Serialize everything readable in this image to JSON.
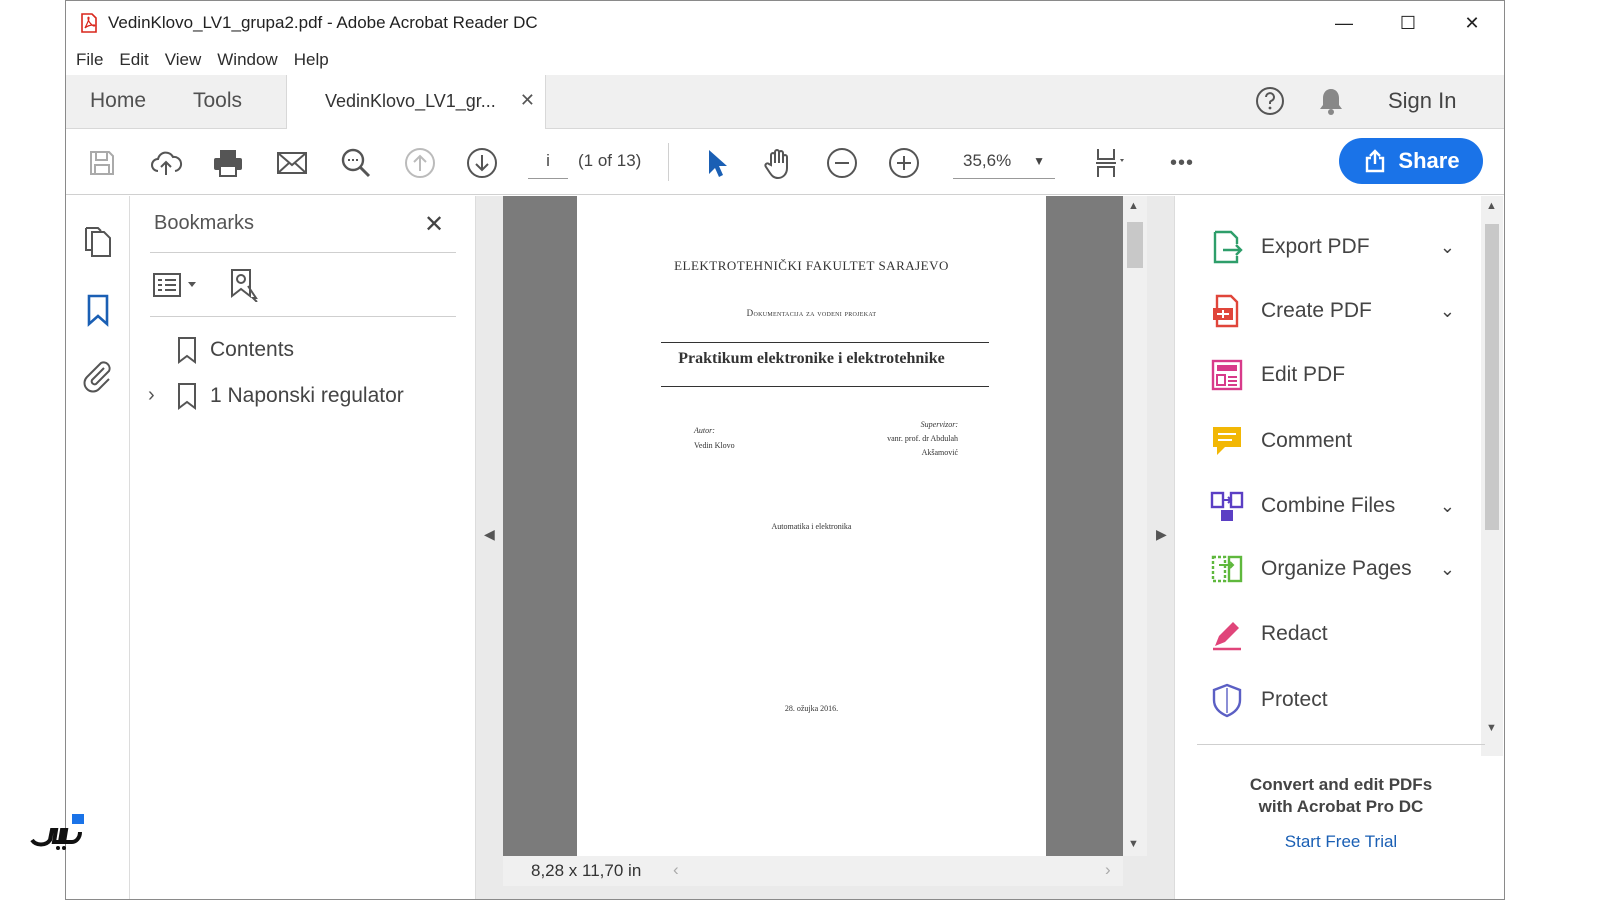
{
  "window": {
    "title": "VedinKlovo_LV1_grupa2.pdf - Adobe Acrobat Reader DC",
    "controls": [
      "—",
      "☐",
      "✕"
    ]
  },
  "menu": [
    "File",
    "Edit",
    "View",
    "Window",
    "Help"
  ],
  "tabs": {
    "home": "Home",
    "tools": "Tools",
    "document": "VedinKlovo_LV1_gr...",
    "close": "✕"
  },
  "account": {
    "sign_in": "Sign In"
  },
  "toolbar": {
    "page_input": "i",
    "page_count": "(1 of 13)",
    "zoom": "35,6%",
    "share": "Share",
    "more": "•••"
  },
  "bookmarks": {
    "title": "Bookmarks",
    "close": "✕",
    "items": [
      {
        "label": "Contents",
        "expandable": false
      },
      {
        "label": "1 Naponski regulator",
        "expandable": true
      }
    ]
  },
  "document": {
    "faculty": "ELEKTROTEHNIČKI FAKULTET SARAJEVO",
    "subtitle": "Dokumentacija za vodeni projekat",
    "title": "Praktikum elektronike i elektrotehnike",
    "author_label": "Autor:",
    "author_name": "Vedin Klovo",
    "supervisor_label": "Supervizor:",
    "supervisor_name_1": "vanr. prof. dr Abdulah",
    "supervisor_name_2": "Akšamović",
    "department": "Automatika i elektronika",
    "date": "28. ožujka 2016.",
    "page_size": "8,28 x 11,70 in"
  },
  "tools_pane": {
    "items": [
      {
        "label": "Export PDF",
        "icon": "export-pdf-icon",
        "color": "#2e9e6a",
        "dropdown": true
      },
      {
        "label": "Create PDF",
        "icon": "create-pdf-icon",
        "color": "#e0453a",
        "dropdown": true
      },
      {
        "label": "Edit PDF",
        "icon": "edit-pdf-icon",
        "color": "#d83a8a",
        "dropdown": false
      },
      {
        "label": "Comment",
        "icon": "comment-icon",
        "color": "#f2b705",
        "dropdown": false
      },
      {
        "label": "Combine Files",
        "icon": "combine-files-icon",
        "color": "#5b3fc4",
        "dropdown": true
      },
      {
        "label": "Organize Pages",
        "icon": "organize-pages-icon",
        "color": "#5fb83d",
        "dropdown": true
      },
      {
        "label": "Redact",
        "icon": "redact-icon",
        "color": "#e0457a",
        "dropdown": false
      },
      {
        "label": "Protect",
        "icon": "protect-icon",
        "color": "#5b5fc4",
        "dropdown": false
      }
    ],
    "promo_line1": "Convert and edit PDFs",
    "promo_line2": "with Acrobat Pro DC",
    "trial": "Start Free Trial"
  },
  "colors": {
    "accent": "#1a73e8",
    "panel_bg": "#f0f0f0",
    "doc_gray": "#7b7b7b"
  }
}
